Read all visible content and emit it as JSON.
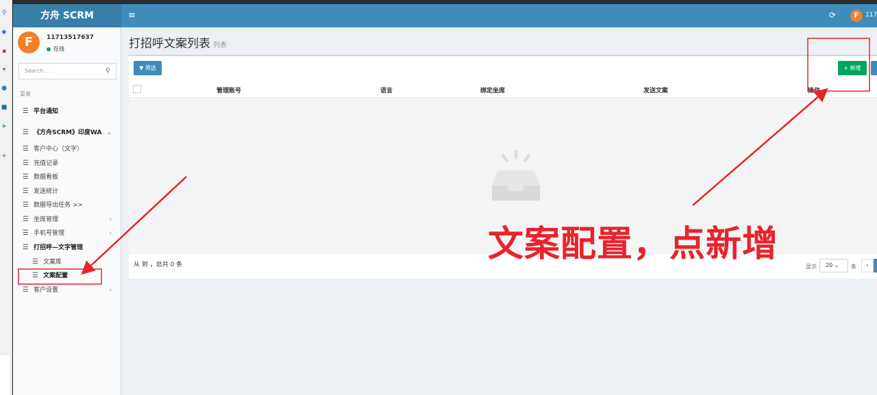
{
  "app": {
    "logo": "方舟 SCRM",
    "top_user": "117",
    "avatar_letter": "F"
  },
  "user": {
    "name": "11713517637",
    "status": "在线"
  },
  "sidebar": {
    "search_placeholder": "Search...",
    "menu_header": "菜单",
    "items": [
      {
        "label": "平台通知"
      },
      {
        "label": "《方舟SCRM》印度WA"
      },
      {
        "label": "客户中心（文字）"
      },
      {
        "label": "充值记录"
      },
      {
        "label": "数据看板"
      },
      {
        "label": "发送统计"
      },
      {
        "label": "数据导出任务 >>"
      },
      {
        "label": "坐席管理"
      },
      {
        "label": "手机号管理"
      },
      {
        "label": "打招呼—文字管理"
      },
      {
        "label": "文案库"
      },
      {
        "label": "文案配置"
      },
      {
        "label": "客户设置"
      }
    ]
  },
  "page": {
    "title": "打招呼文案列表",
    "subtitle": "列表"
  },
  "toolbar": {
    "filter_label": "筛选",
    "add_label": "新增"
  },
  "table": {
    "columns": [
      "管理账号",
      "语言",
      "绑定坐席",
      "发送文案",
      "操作"
    ],
    "footer_info": "从 到 ，总共 0 条"
  },
  "pager": {
    "show_label": "显示",
    "page_size": "20",
    "unit_label": "条",
    "prev": "‹"
  },
  "annotation": {
    "text": "文案配置，点新增",
    "color": "#e8232b"
  }
}
